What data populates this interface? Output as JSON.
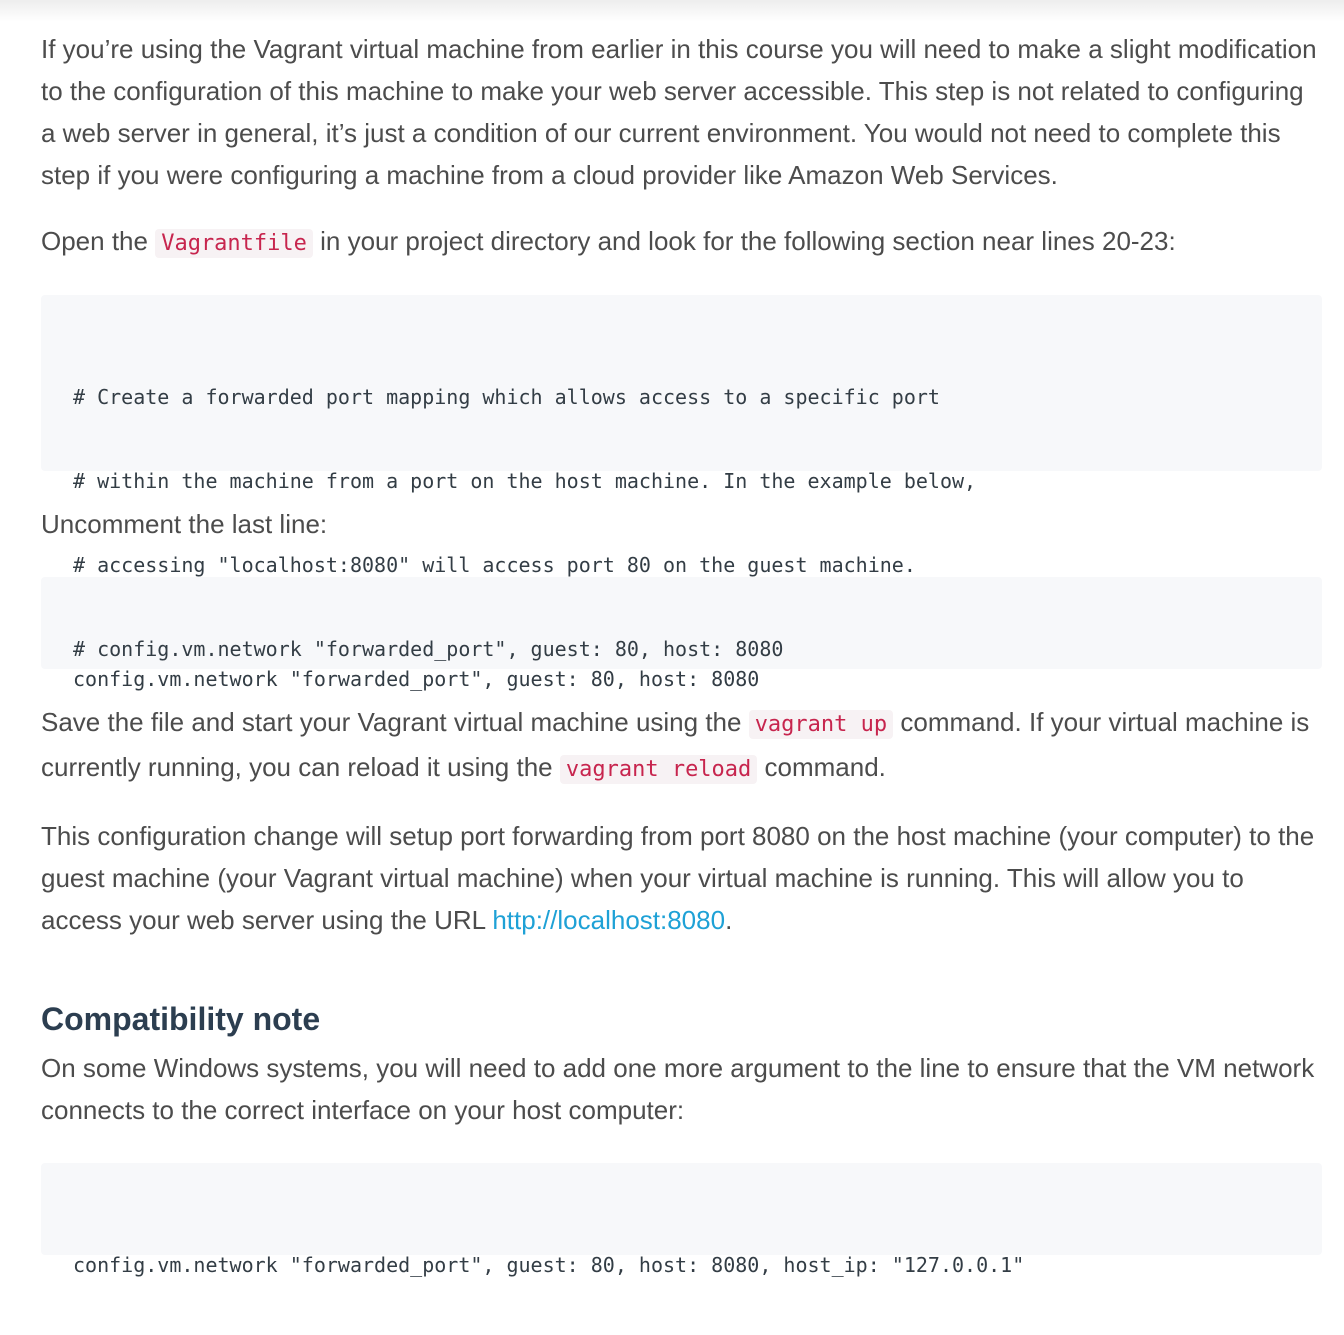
{
  "para1": "If you’re using the Vagrant virtual machine from earlier in this course you will need to make a slight modification to the configuration of this machine to make your web server accessible. This step is not related to configuring a web server in general, it’s just a condition of our current environment. You would not need to complete this step if you were configuring a machine from a cloud provider like Amazon Web Services.",
  "para2": {
    "before": "Open the ",
    "code": "Vagrantfile",
    "after": " in your project directory and look for the following section near lines 20-23:"
  },
  "code1": [
    "# Create a forwarded port mapping which allows access to a specific port",
    "# within the machine from a port on the host machine. In the example below,",
    "# accessing \"localhost:8080\" will access port 80 on the guest machine.",
    "# config.vm.network \"forwarded_port\", guest: 80, host: 8080"
  ],
  "para3": "Uncomment the last line:",
  "code2": "config.vm.network \"forwarded_port\", guest: 80, host: 8080",
  "para4": {
    "t1": "Save the file and start your Vagrant virtual machine using the ",
    "c1": "vagrant up",
    "t2": " command. If your virtual machine is currently running, you can reload it using the ",
    "c2": "vagrant reload",
    "t3": " command."
  },
  "para5": {
    "text": "This configuration change will setup port forwarding from port 8080 on the host machine (your computer) to the guest machine (your Vagrant virtual machine) when your virtual machine is running. This will allow you to access your web server using the URL ",
    "link": "http://localhost:8080",
    "end": "."
  },
  "heading": "Compatibility note",
  "para6": "On some Windows systems, you will need to add one more argument to the line to ensure that the VM network connects to the correct interface on your host computer:",
  "code3": "config.vm.network \"forwarded_port\", guest: 80, host: 8080, host_ip: \"127.0.0.1\"",
  "colors": {
    "inline_code": "#c7254e",
    "link": "#1ea1d6",
    "heading": "#2c3e50",
    "code_bg": "#f7f8fa"
  }
}
